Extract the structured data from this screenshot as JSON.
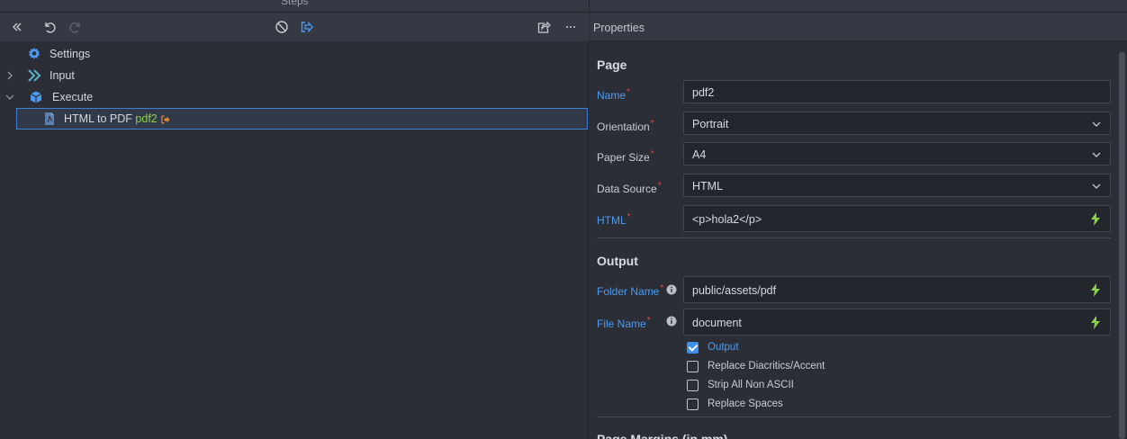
{
  "steps_panel": {
    "title": "Steps",
    "tree": [
      {
        "label": "Settings",
        "icon": "gear-icon"
      },
      {
        "label": "Input",
        "icon": "double-chevron-right-icon"
      },
      {
        "label": "Execute",
        "icon": "cube-icon"
      },
      {
        "label": "HTML to PDF",
        "suffix": "pdf2",
        "icon": "pdf-file-icon",
        "selected": true
      }
    ]
  },
  "properties": {
    "title": "Properties",
    "page_section": {
      "title": "Page",
      "fields": [
        {
          "label": "Name",
          "value": "pdf2"
        },
        {
          "label": "Orientation",
          "value": "Portrait"
        },
        {
          "label": "Paper Size",
          "value": "A4"
        },
        {
          "label": "Data Source",
          "value": "HTML"
        },
        {
          "label": "HTML",
          "value": "<p>hola2</p>"
        }
      ]
    },
    "output_section": {
      "title": "Output",
      "fields": [
        {
          "label": "Folder Name",
          "value": "public/assets/pdf"
        },
        {
          "label": "File Name",
          "value": "document"
        }
      ],
      "checkboxes": [
        {
          "label": "Output",
          "checked": true
        },
        {
          "label": "Replace Diacritics/Accent",
          "checked": false
        },
        {
          "label": "Strip All Non ASCII",
          "checked": false
        },
        {
          "label": "Replace Spaces",
          "checked": false
        }
      ]
    },
    "margins_section": {
      "title": "Page Margins (in mm)"
    }
  },
  "colors": {
    "accent_blue": "#4d9bf0",
    "green": "#8ccf4d",
    "orange": "#e8892f",
    "required_red": "#e0464a"
  }
}
